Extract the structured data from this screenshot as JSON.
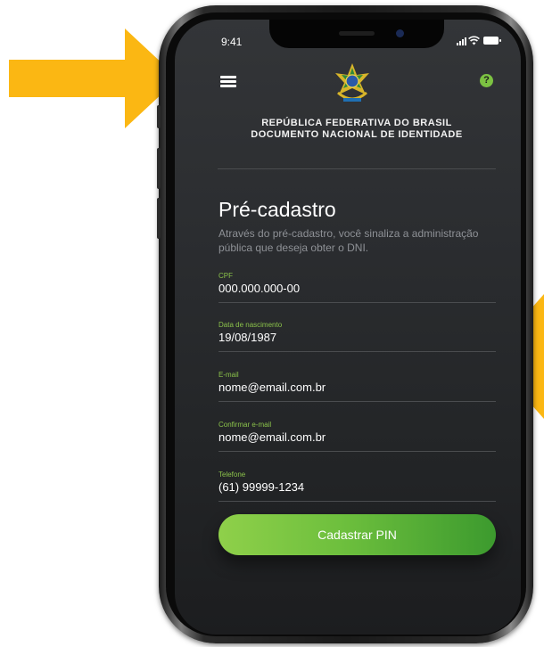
{
  "status_bar": {
    "time": "9:41"
  },
  "header": {
    "line1": "REPÚBLICA FEDERATIVA DO BRASIL",
    "line2": "DOCUMENTO NACIONAL DE IDENTIDADE",
    "help_glyph": "?"
  },
  "main": {
    "title": "Pré-cadastro",
    "description": "Através do pré-cadastro, você sinaliza a administração pública que deseja obter o DNI."
  },
  "form": {
    "fields": [
      {
        "label": "CPF",
        "value": "000.000.000-00"
      },
      {
        "label": "Data de nascimento",
        "value": "19/08/1987"
      },
      {
        "label": "E-mail",
        "value": "nome@email.com.br"
      },
      {
        "label": "Confirmar e-mail",
        "value": "nome@email.com.br"
      },
      {
        "label": "Telefone",
        "value": "(61) 99999-1234"
      }
    ],
    "submit_label": "Cadastrar PIN"
  },
  "colors": {
    "accent": "#8bc34a",
    "arrow": "#fbb713",
    "screen_bg": "#2b2d30"
  },
  "icons": [
    "menu-icon",
    "help-icon",
    "coat-of-arms-icon",
    "signal-icon",
    "wifi-icon",
    "battery-icon"
  ]
}
